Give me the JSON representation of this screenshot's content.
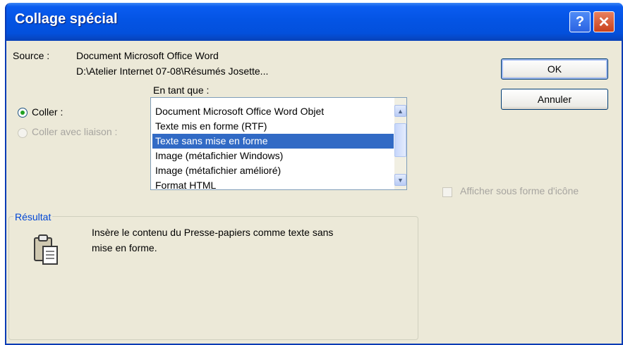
{
  "window": {
    "title": "Collage spécial"
  },
  "titlebar": {
    "help_glyph": "?",
    "close_glyph": "✕"
  },
  "source": {
    "label": "Source :",
    "line1": "Document Microsoft Office Word",
    "line2": "D:\\Atelier Internet 07-08\\Résumés Josette..."
  },
  "as_label": "En tant que :",
  "options": {
    "paste_label": "Coller :",
    "paste_selected": true,
    "paste_link_label": "Coller avec liaison :",
    "paste_link_enabled": false
  },
  "list": {
    "items": [
      "Document Microsoft Office Word Objet",
      "Texte mis en forme (RTF)",
      "Texte sans mise en forme",
      "Image (métafichier Windows)",
      "Image (métafichier amélioré)",
      "Format HTML"
    ],
    "selected": "Texte sans mise en forme"
  },
  "buttons": {
    "ok": "OK",
    "cancel": "Annuler"
  },
  "display_as_icon": {
    "label": "Afficher sous forme d'icône",
    "checked": false,
    "enabled": false
  },
  "result": {
    "label": "Résultat",
    "line1": "Insère le contenu du Presse-papiers comme texte sans",
    "line2": "mise en forme.",
    "icon": "clipboard-icon"
  }
}
